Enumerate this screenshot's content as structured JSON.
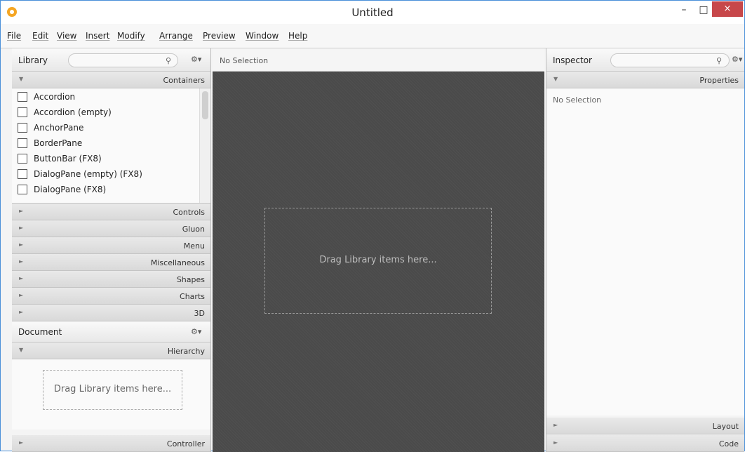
{
  "window": {
    "title": "Untitled",
    "minimize": "–",
    "maximize": "□",
    "close": "×"
  },
  "menu": [
    "File",
    "Edit",
    "View",
    "Insert",
    "Modify",
    "Arrange",
    "Preview",
    "Window",
    "Help"
  ],
  "library": {
    "title": "Library",
    "section_open": "Containers",
    "items": [
      "Accordion",
      "Accordion  (empty)",
      "AnchorPane",
      "BorderPane",
      "ButtonBar  (FX8)",
      "DialogPane (empty)  (FX8)",
      "DialogPane  (FX8)"
    ],
    "sections": [
      "Controls",
      "Gluon",
      "Menu",
      "Miscellaneous",
      "Shapes",
      "Charts",
      "3D"
    ]
  },
  "document": {
    "title": "Document",
    "section": "Hierarchy",
    "drop_hint": "Drag Library items here...",
    "footer_section": "Controller"
  },
  "center": {
    "selection": "No Selection",
    "drop_hint": "Drag Library items here..."
  },
  "inspector": {
    "title": "Inspector",
    "section": "Properties",
    "selection": "No Selection",
    "sections": [
      "Layout",
      "Code"
    ]
  },
  "icons": {
    "search": "⚲",
    "gear": "⚙▾",
    "collapsed": "►",
    "expanded": "▼"
  },
  "colors": {
    "accent": "#f5a623",
    "close": "#c7474a",
    "canvas": "#4a4a4a"
  }
}
